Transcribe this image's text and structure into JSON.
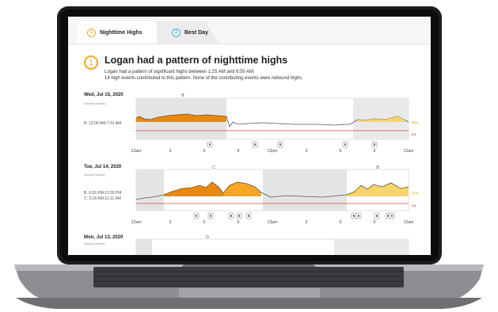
{
  "tabs": [
    {
      "number": "1",
      "label": "Nighttime Highs"
    },
    {
      "number": "2",
      "label": "Best Day"
    }
  ],
  "header": {
    "number": "1",
    "title": "Logan had a pattern of nighttime highs",
    "line1": "Logan had a pattern of significant highs between 1:25 AM and 6:50 AM.",
    "line2": "14 high events contributed to this pattern. None of the contributing events were rebound highs."
  },
  "glucose_label": "Glucose (mmol/L)",
  "time_ticks": [
    "12am",
    "3",
    "6",
    "9",
    "12pm",
    "3",
    "6",
    "9",
    "12am"
  ],
  "target_high": "10.0",
  "target_low": "3.9",
  "days": [
    {
      "date": "Wed, Jul 15, 2020",
      "ranges": [
        "B: 12:06 AM-7:51 AM"
      ],
      "markers": [
        "B"
      ]
    },
    {
      "date": "Tue, Jul 14, 2020",
      "ranges": [
        "B: 6:26 PM-11:59 PM",
        "C: 2:16 AM-11:11 AM"
      ],
      "markers": [
        "C",
        "B"
      ]
    },
    {
      "date": "Mon, Jul 13, 2020",
      "ranges": [],
      "markers": [
        "D"
      ]
    }
  ],
  "colors": {
    "orange": "#f5a623",
    "dark_orange": "#e8890f",
    "yellow": "#f8d56a",
    "blue": "#3fb6e0",
    "low_red": "#e04040",
    "shade": "#e2e2e2"
  }
}
